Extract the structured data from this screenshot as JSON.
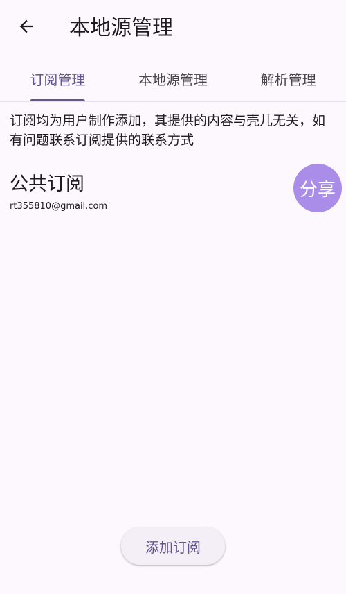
{
  "app_bar": {
    "back_icon": "arrow-left-icon",
    "title": "本地源管理"
  },
  "tabs": [
    {
      "label": "订阅管理",
      "active": true
    },
    {
      "label": "本地源管理",
      "active": false
    },
    {
      "label": "解析管理",
      "active": false
    }
  ],
  "notice": {
    "text": "订阅均为用户制作添加，其提供的内容与壳儿无关，如有问题联系订阅提供的联系方式"
  },
  "subscription": {
    "title": "公共订阅",
    "contact": "rt355810@gmail.com",
    "share_label": "分享"
  },
  "add_button": {
    "label": "添加订阅"
  },
  "colors": {
    "accent": "#65558f",
    "share_button": "#a98de8",
    "background": "#fdf8fd"
  }
}
